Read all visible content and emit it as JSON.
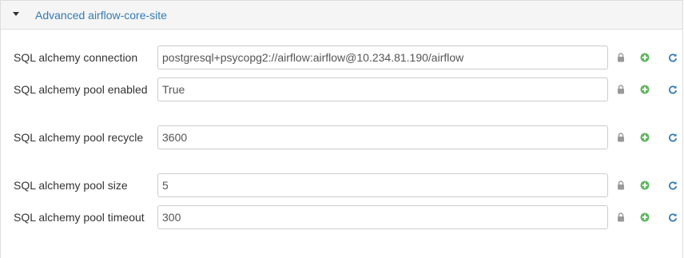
{
  "section": {
    "title": "Advanced airflow-core-site"
  },
  "properties": [
    {
      "label": "SQL alchemy connection",
      "value": "postgresql+psycopg2://airflow:airflow@10.234.81.190/airflow"
    },
    {
      "label": "SQL alchemy pool enabled",
      "value": "True"
    },
    {
      "label": "SQL alchemy pool recycle",
      "value": "3600"
    },
    {
      "label": "SQL alchemy pool size",
      "value": "5"
    },
    {
      "label": "SQL alchemy pool timeout",
      "value": "300"
    }
  ],
  "icons": {
    "collapse": "caret-down-icon",
    "lock": "lock-icon",
    "add": "plus-circle-icon",
    "refresh": "refresh-icon"
  },
  "colors": {
    "link": "#337ab7",
    "add_icon": "#5cb85c",
    "refresh_icon": "#337ab7",
    "lock_icon": "#999999"
  }
}
